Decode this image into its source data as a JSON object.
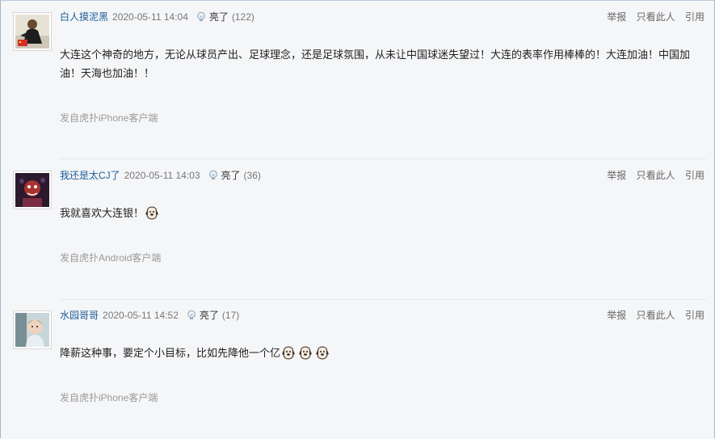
{
  "action_labels": {
    "report": "举报",
    "only_this_user": "只看此人",
    "quote": "引用",
    "light": "亮了"
  },
  "posts": [
    {
      "username": "白人摸泥黑",
      "time": "2020-05-11 14:04",
      "light_count": "(122)",
      "content": "大连这个神奇的地方，无论从球员产出、足球理念，还是足球氛围，从未让中国球迷失望过！大连的表率作用棒棒的！大连加油！中国加油！天海也加油！！",
      "emoji_count": 0,
      "source": "发自虎扑iPhone客户端"
    },
    {
      "username": "我还是太CJ了",
      "time": "2020-05-11 14:03",
      "light_count": "(36)",
      "content": "我就喜欢大连银！",
      "emoji_count": 1,
      "source": "发自虎扑Android客户端"
    },
    {
      "username": "水园哥哥",
      "time": "2020-05-11 14:52",
      "light_count": "(17)",
      "content": "降薪这种事，要定个小目标，比如先降他一个亿",
      "emoji_count": 3,
      "source": "发自虎扑iPhone客户端"
    }
  ],
  "colors": {
    "username": "#1b5d98",
    "background": "#f5f6f8",
    "muted": "#999999"
  }
}
